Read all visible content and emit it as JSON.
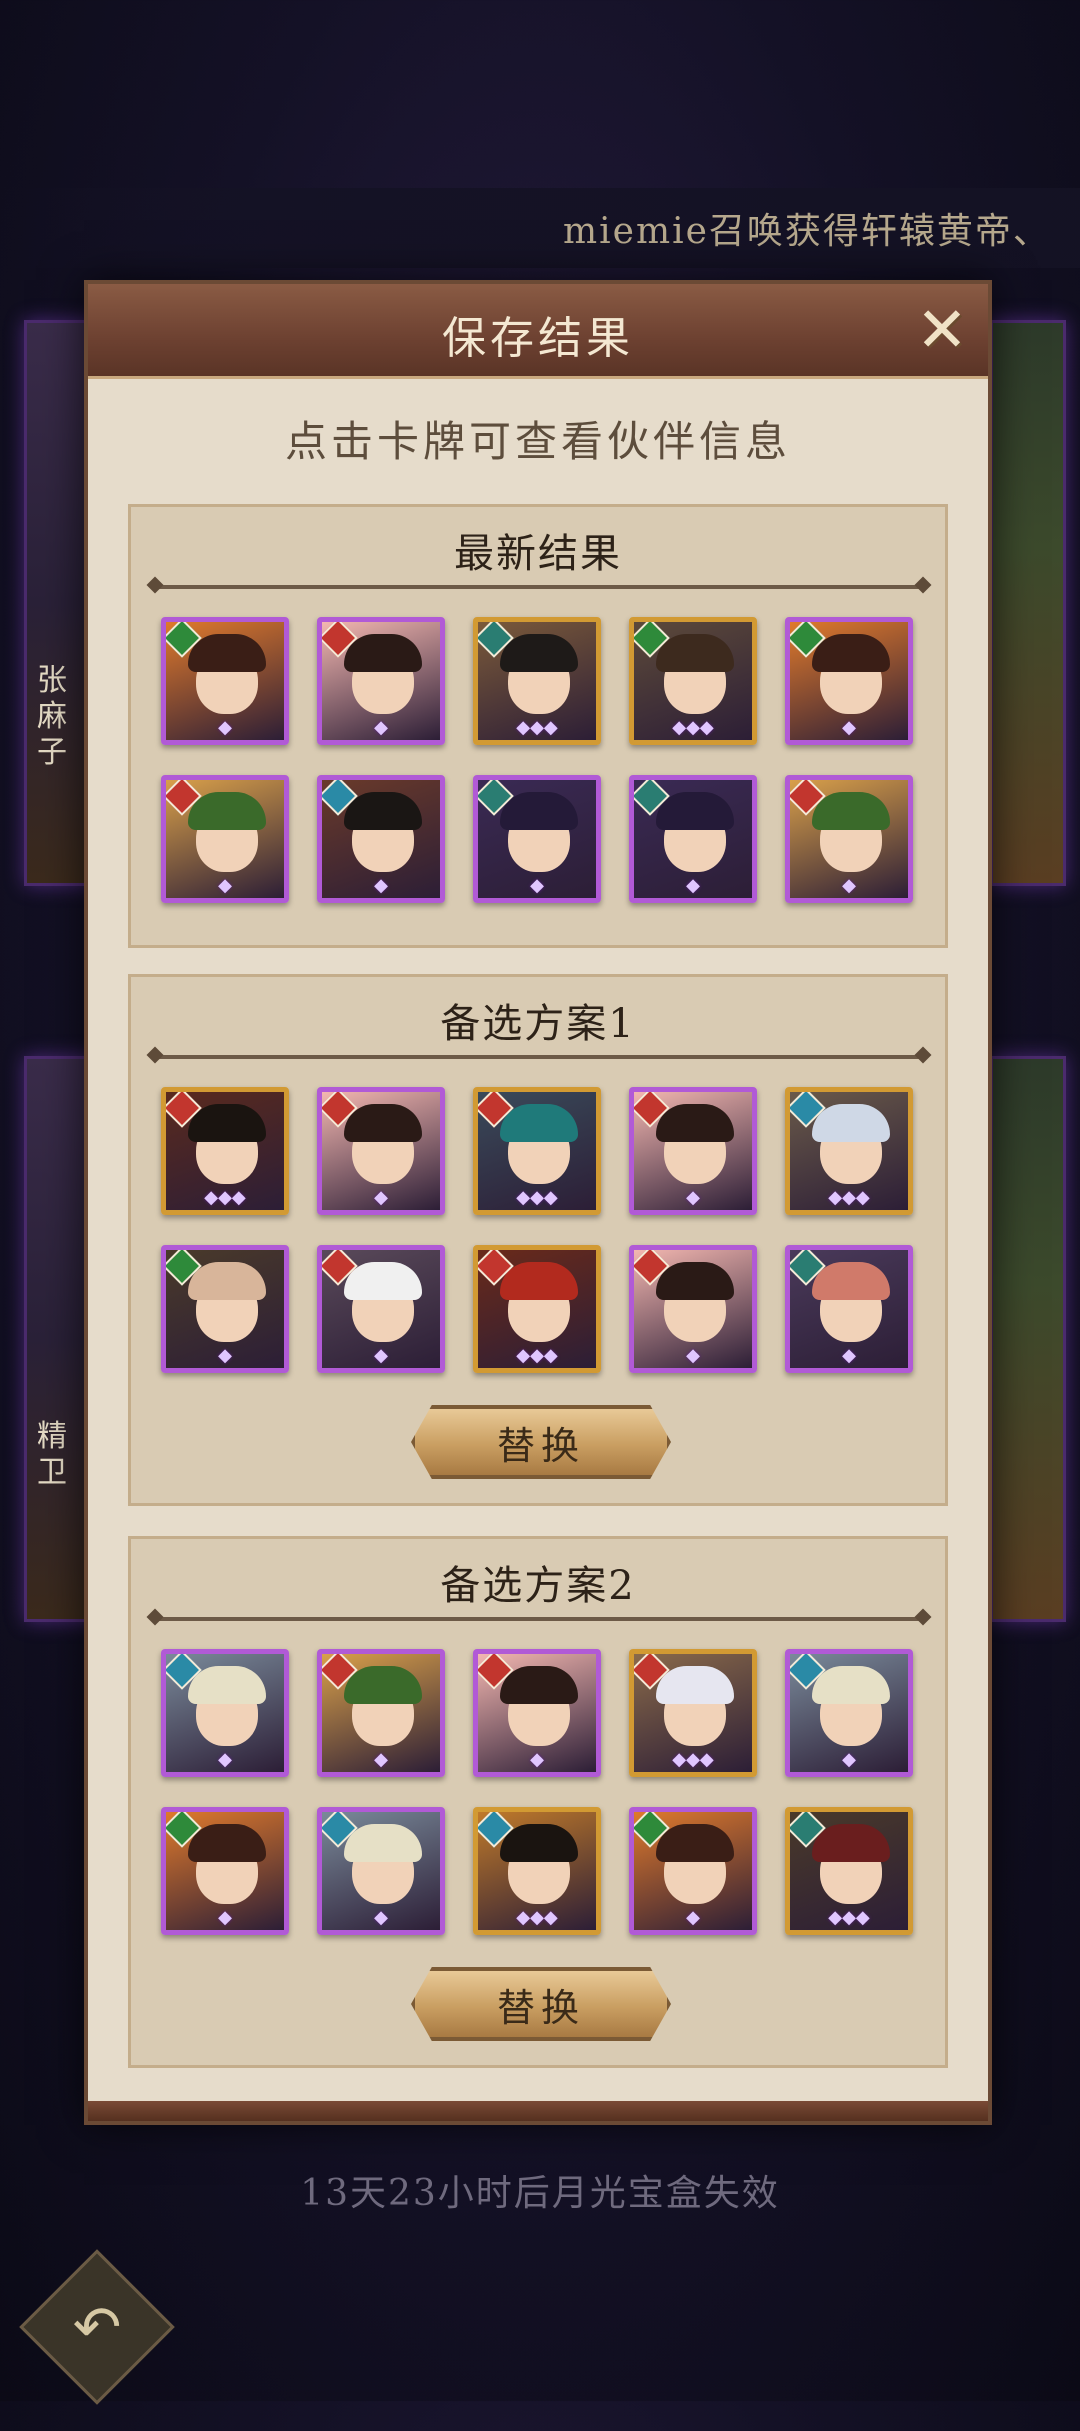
{
  "banner": {
    "text": "miemie召唤获得轩辕黄帝、"
  },
  "background": {
    "left_cards": [
      {
        "name": "张麻子"
      },
      {
        "name": "精卫"
      }
    ]
  },
  "modal": {
    "title": "保存结果",
    "close_icon": "close-icon",
    "hint": "点击卡牌可查看伙伴信息",
    "swap_label": "替换",
    "sections": [
      {
        "title": "最新结果",
        "cards": [
          {
            "faction": "#2e8a3a",
            "rarity": "purple",
            "stars": 1,
            "hair": "#3a1e16",
            "bg": "#e07a2c"
          },
          {
            "faction": "#c2362e",
            "rarity": "purple",
            "stars": 1,
            "hair": "#2a1a16",
            "bg": "#f3b7b0"
          },
          {
            "faction": "#2a7d72",
            "rarity": "gold",
            "stars": 3,
            "hair": "#1e1a18",
            "bg": "#7b5a3a"
          },
          {
            "faction": "#2e8a3a",
            "rarity": "gold",
            "stars": 3,
            "hair": "#3d2a1e",
            "bg": "#5d4a3a"
          },
          {
            "faction": "#2e8a3a",
            "rarity": "purple",
            "stars": 1,
            "hair": "#3a1e16",
            "bg": "#e07a2c"
          },
          {
            "faction": "#c2362e",
            "rarity": "purple",
            "stars": 1,
            "hair": "#3a6a2a",
            "bg": "#d9a04a"
          },
          {
            "faction": "#2a8aa6",
            "rarity": "purple",
            "stars": 1,
            "hair": "#1a1614",
            "bg": "#6a3a2a"
          },
          {
            "faction": "#2a7d72",
            "rarity": "purple",
            "stars": 1,
            "hair": "#241a38",
            "bg": "#3a2a54"
          },
          {
            "faction": "#2a7d72",
            "rarity": "purple",
            "stars": 1,
            "hair": "#241a38",
            "bg": "#3a2a54"
          },
          {
            "faction": "#c2362e",
            "rarity": "purple",
            "stars": 1,
            "hair": "#3a6a2a",
            "bg": "#d9a04a"
          }
        ]
      },
      {
        "title": "备选方案1",
        "cards": [
          {
            "faction": "#c2362e",
            "rarity": "gold",
            "stars": 3,
            "hair": "#1a1410",
            "bg": "#5a2a1e"
          },
          {
            "faction": "#c2362e",
            "rarity": "purple",
            "stars": 1,
            "hair": "#2a1a16",
            "bg": "#f3b7b0"
          },
          {
            "faction": "#c2362e",
            "rarity": "gold",
            "stars": 3,
            "hair": "#1f7a7a",
            "bg": "#3a4a5a"
          },
          {
            "faction": "#c2362e",
            "rarity": "purple",
            "stars": 1,
            "hair": "#2a1a16",
            "bg": "#f3b7b0"
          },
          {
            "faction": "#2a8aa6",
            "rarity": "gold",
            "stars": 3,
            "hair": "#cfd8e6",
            "bg": "#6a5a4a"
          },
          {
            "faction": "#2e8a3a",
            "rarity": "purple",
            "stars": 1,
            "hair": "#d8b59a",
            "bg": "#4a3a2a"
          },
          {
            "faction": "#c2362e",
            "rarity": "purple",
            "stars": 1,
            "hair": "#f0f0f0",
            "bg": "#5a4a5a"
          },
          {
            "faction": "#c2362e",
            "rarity": "gold",
            "stars": 3,
            "hair": "#b22a1e",
            "bg": "#6a2a1a"
          },
          {
            "faction": "#c2362e",
            "rarity": "purple",
            "stars": 1,
            "hair": "#2a1a16",
            "bg": "#f3b7b0"
          },
          {
            "faction": "#2a7d72",
            "rarity": "purple",
            "stars": 1,
            "hair": "#d07a6a",
            "bg": "#4a3a5a"
          }
        ]
      },
      {
        "title": "备选方案2",
        "cards": [
          {
            "faction": "#2a8aa6",
            "rarity": "purple",
            "stars": 1,
            "hair": "#e6e0c6",
            "bg": "#7a8a9a"
          },
          {
            "faction": "#c2362e",
            "rarity": "purple",
            "stars": 1,
            "hair": "#3a6a2a",
            "bg": "#d9a04a"
          },
          {
            "faction": "#c2362e",
            "rarity": "purple",
            "stars": 1,
            "hair": "#2a1a16",
            "bg": "#f3b7b0"
          },
          {
            "faction": "#c2362e",
            "rarity": "gold",
            "stars": 3,
            "hair": "#e6e6f0",
            "bg": "#8a6a4a"
          },
          {
            "faction": "#2a8aa6",
            "rarity": "purple",
            "stars": 1,
            "hair": "#e6e0c6",
            "bg": "#7a8a9a"
          },
          {
            "faction": "#2e8a3a",
            "rarity": "purple",
            "stars": 1,
            "hair": "#3a1e16",
            "bg": "#e07a2c"
          },
          {
            "faction": "#2a8aa6",
            "rarity": "purple",
            "stars": 1,
            "hair": "#e6e0c6",
            "bg": "#7a8a9a"
          },
          {
            "faction": "#2a8aa6",
            "rarity": "gold",
            "stars": 3,
            "hair": "#1a1410",
            "bg": "#c07a2a"
          },
          {
            "faction": "#2e8a3a",
            "rarity": "purple",
            "stars": 1,
            "hair": "#3a1e16",
            "bg": "#e07a2c"
          },
          {
            "faction": "#2a7d72",
            "rarity": "gold",
            "stars": 3,
            "hair": "#6a1e1e",
            "bg": "#4a3a2a"
          }
        ]
      }
    ]
  },
  "expire_text": "13天23小时后月光宝盒失效",
  "back_icon": "back-arrow-icon"
}
